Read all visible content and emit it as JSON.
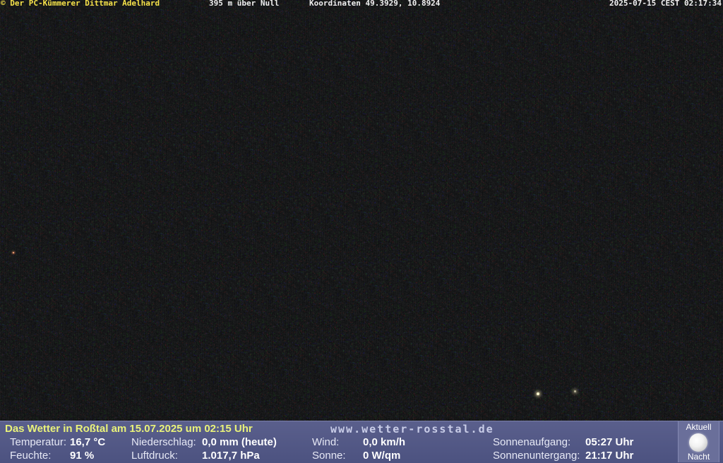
{
  "overlay": {
    "copyright": "© Der PC-Kümmerer Dittmar Adelhard",
    "altitude": "395 m über Null",
    "coordinates": "Koordinaten 49.3929, 10.8924",
    "timestamp": "2025-07-15 CEST 02:17:34"
  },
  "weather": {
    "title": "Das Wetter in Roßtal am 15.07.2025 um 02:15 Uhr",
    "url": "www.wetter-rosstal.de",
    "temperature": {
      "label": "Temperatur:",
      "value": "16,7 °C"
    },
    "humidity": {
      "label": "Feuchte:",
      "value": "91 %"
    },
    "precipitation": {
      "label": "Niederschlag:",
      "value": "0,0 mm (heute)"
    },
    "pressure": {
      "label": "Luftdruck:",
      "value": "1.017,7 hPa"
    },
    "wind": {
      "label": "Wind:",
      "value": "0,0 km/h"
    },
    "sun": {
      "label": "Sonne:",
      "value": "0 W/qm"
    },
    "sunrise": {
      "label": "Sonnenaufgang:",
      "value": "05:27 Uhr"
    },
    "sunset": {
      "label": "Sonnenuntergang:",
      "value": "21:17 Uhr"
    },
    "moon": {
      "top_label": "Aktuell",
      "bottom_label": "Nacht",
      "icon": "full-moon-icon"
    }
  },
  "colors": {
    "title_text": "#e9f27a",
    "copyright_text": "#f7e34a",
    "panel_bg": "#555a88"
  }
}
